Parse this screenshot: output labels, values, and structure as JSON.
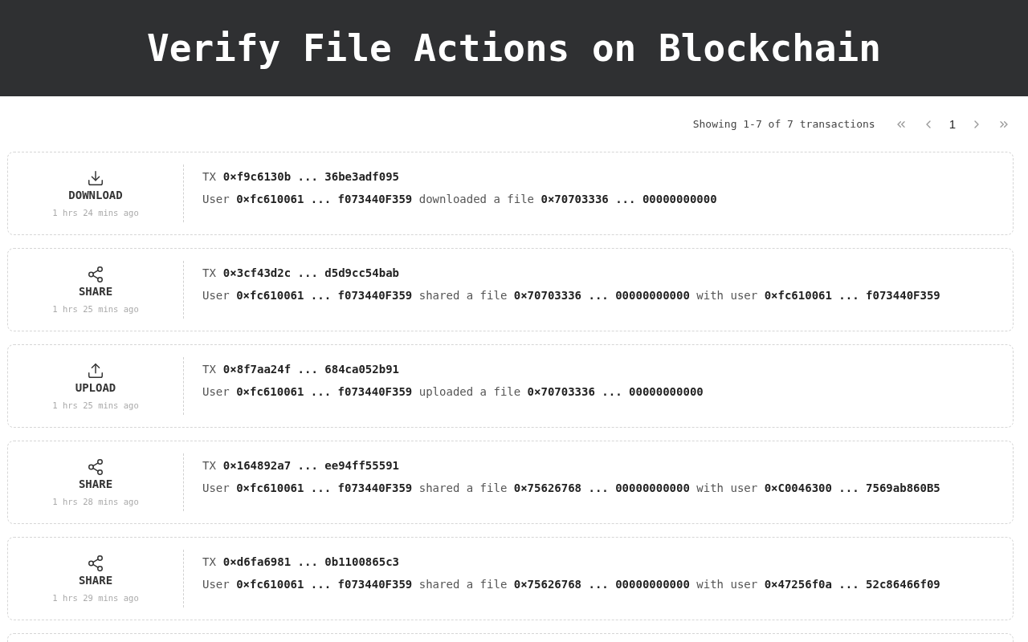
{
  "header": {
    "title": "Verify File Actions on Blockchain"
  },
  "pagination": {
    "summary": "Showing 1-7 of 7 transactions",
    "page": "1"
  },
  "transactions": [
    {
      "kind": "download",
      "label": "DOWNLOAD",
      "time": "1 hrs 24 mins ago",
      "tx_label": "TX",
      "tx": "0×f9c6130b ... 36be3adf095",
      "description": "User **0×fc610061 ... f073440F359** downloaded a file **0×70703336 ... 00000000000**"
    },
    {
      "kind": "share",
      "label": "SHARE",
      "time": "1 hrs 25 mins ago",
      "tx_label": "TX",
      "tx": "0×3cf43d2c ... d5d9cc54bab",
      "description": "User **0×fc610061 ... f073440F359** shared a file **0×70703336 ... 00000000000** with user **0×fc610061 ... f073440F359**"
    },
    {
      "kind": "upload",
      "label": "UPLOAD",
      "time": "1 hrs 25 mins ago",
      "tx_label": "TX",
      "tx": "0×8f7aa24f ... 684ca052b91",
      "description": "User **0×fc610061 ... f073440F359** uploaded a file **0×70703336 ... 00000000000**"
    },
    {
      "kind": "share",
      "label": "SHARE",
      "time": "1 hrs 28 mins ago",
      "tx_label": "TX",
      "tx": "0×164892a7 ... ee94ff55591",
      "description": "User **0×fc610061 ... f073440F359** shared a file **0×75626768 ... 00000000000** with user **0×C0046300 ... 7569ab860B5**"
    },
    {
      "kind": "share",
      "label": "SHARE",
      "time": "1 hrs 29 mins ago",
      "tx_label": "TX",
      "tx": "0×d6fa6981 ... 0b1100865c3",
      "description": "User **0×fc610061 ... f073440F359** shared a file **0×75626768 ... 00000000000** with user **0×47256f0a ... 52c86466f09**"
    }
  ]
}
